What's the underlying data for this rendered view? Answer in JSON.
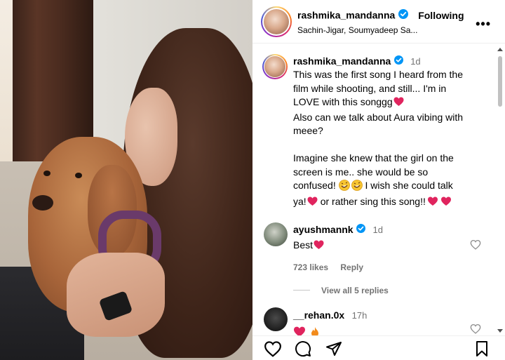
{
  "post": {
    "username": "rashmika_mandanna",
    "follow_label": "Following",
    "audio": "Sachin-Jigar, Soumyadeep Sa...",
    "more_label": "•••"
  },
  "caption": {
    "username": "rashmika_mandanna",
    "time": "1d",
    "lines": [
      "This was the first song I heard from the",
      "film while shooting, and still... I'm in",
      "LOVE with this songgg",
      "Also can we talk about Aura vibing with",
      "meee?",
      "",
      "Imagine she knew that the girl on the",
      "screen is me.. she would be so",
      "confused!",
      "I wish she could talk",
      "ya!",
      "or rather sing this song!!"
    ]
  },
  "comments": [
    {
      "username": "ayushmannk",
      "time": "1d",
      "text": "Best",
      "likes": "723 likes",
      "reply_label": "Reply",
      "view_replies": "View all 5 replies"
    },
    {
      "username": "__rehan.0x",
      "time": "17h"
    }
  ],
  "icons": {
    "verified_color": "#0095f6",
    "heart_red": "#e0245e",
    "like": "heart-icon",
    "comment": "comment-icon",
    "share": "send-icon",
    "save": "bookmark-icon"
  }
}
